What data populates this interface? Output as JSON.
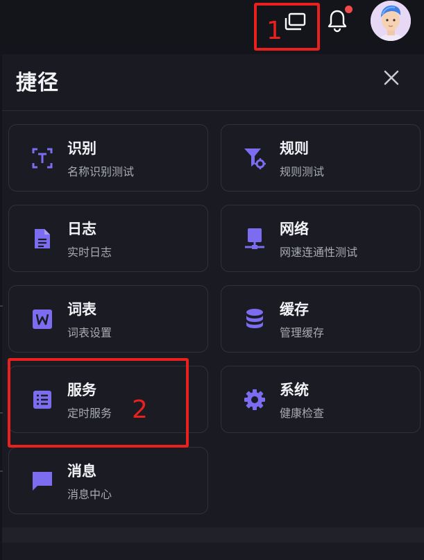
{
  "header": {
    "icons": [
      "windows-icon",
      "bell-icon",
      "avatar"
    ],
    "notification_dot_color": "#f04a4a"
  },
  "panel": {
    "title": "捷径",
    "close_icon": "close-icon"
  },
  "shortcuts": [
    {
      "key": "recognize",
      "title": "识别",
      "subtitle": "名称识别测试",
      "icon": "text-recognize-icon"
    },
    {
      "key": "rules",
      "title": "规则",
      "subtitle": "规则测试",
      "icon": "filter-gear-icon"
    },
    {
      "key": "logs",
      "title": "日志",
      "subtitle": "实时日志",
      "icon": "document-icon"
    },
    {
      "key": "network",
      "title": "网络",
      "subtitle": "网速连通性测试",
      "icon": "network-icon"
    },
    {
      "key": "glossary",
      "title": "词表",
      "subtitle": "词表设置",
      "icon": "word-icon"
    },
    {
      "key": "cache",
      "title": "缓存",
      "subtitle": "管理缓存",
      "icon": "database-icon"
    },
    {
      "key": "services",
      "title": "服务",
      "subtitle": "定时服务",
      "icon": "list-icon"
    },
    {
      "key": "system",
      "title": "系统",
      "subtitle": "健康检查",
      "icon": "gear-icon"
    },
    {
      "key": "messages",
      "title": "消息",
      "subtitle": "消息中心",
      "icon": "chat-icon"
    }
  ],
  "annotations": [
    {
      "label": "1"
    },
    {
      "label": "2"
    }
  ],
  "colors": {
    "accent": "#7b6cf0",
    "annotation": "#e8211f",
    "background": "#14151b"
  }
}
